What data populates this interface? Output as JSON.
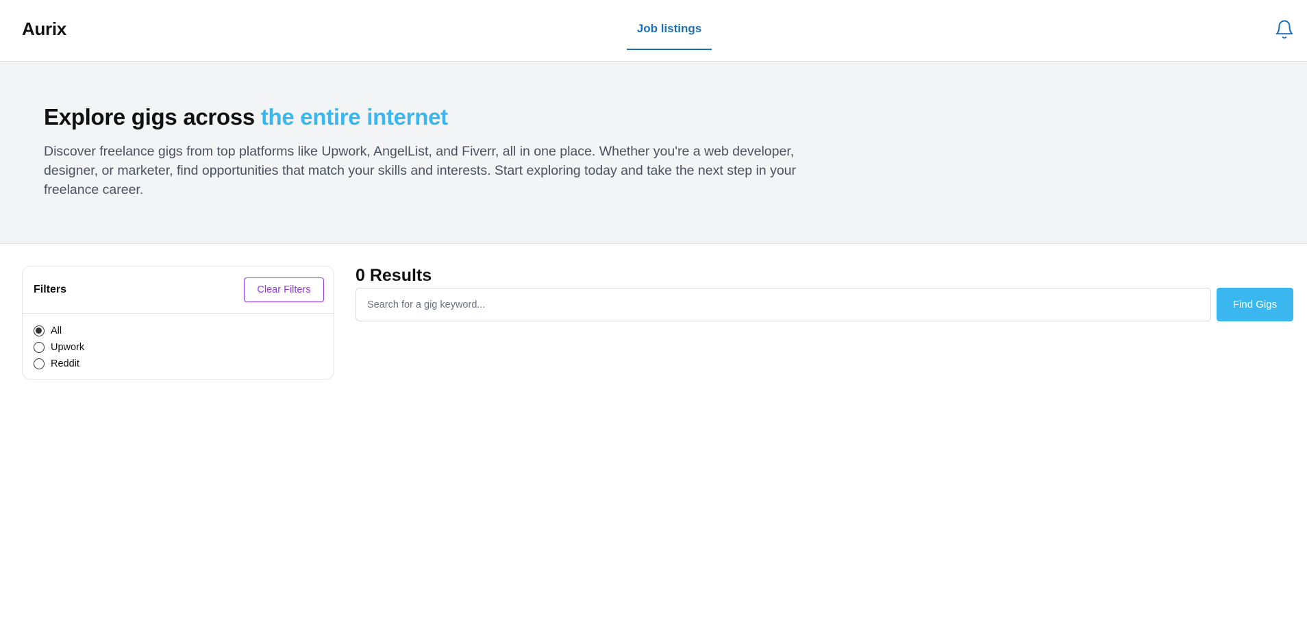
{
  "header": {
    "logo": "Aurix",
    "nav_tab": "Job listings",
    "bell_icon": "bell-icon",
    "accent_color": "#1d6fb3"
  },
  "hero": {
    "title_prefix": "Explore gigs across ",
    "title_accent": "the entire internet",
    "accent_color": "#3ab7ef",
    "description": "Discover freelance gigs from top platforms like Upwork, AngelList, and Fiverr, all in one place. Whether you're a web developer, designer, or marketer, find opportunities that match your skills and interests. Start exploring today and take the next step in your freelance career."
  },
  "filters": {
    "title": "Filters",
    "clear_label": "Clear Filters",
    "options": [
      {
        "label": "All",
        "checked": true
      },
      {
        "label": "Upwork",
        "checked": false
      },
      {
        "label": "Reddit",
        "checked": false
      }
    ]
  },
  "results": {
    "title": "0 Results",
    "search_placeholder": "Search for a gig keyword...",
    "search_value": "",
    "find_label": "Find Gigs"
  }
}
